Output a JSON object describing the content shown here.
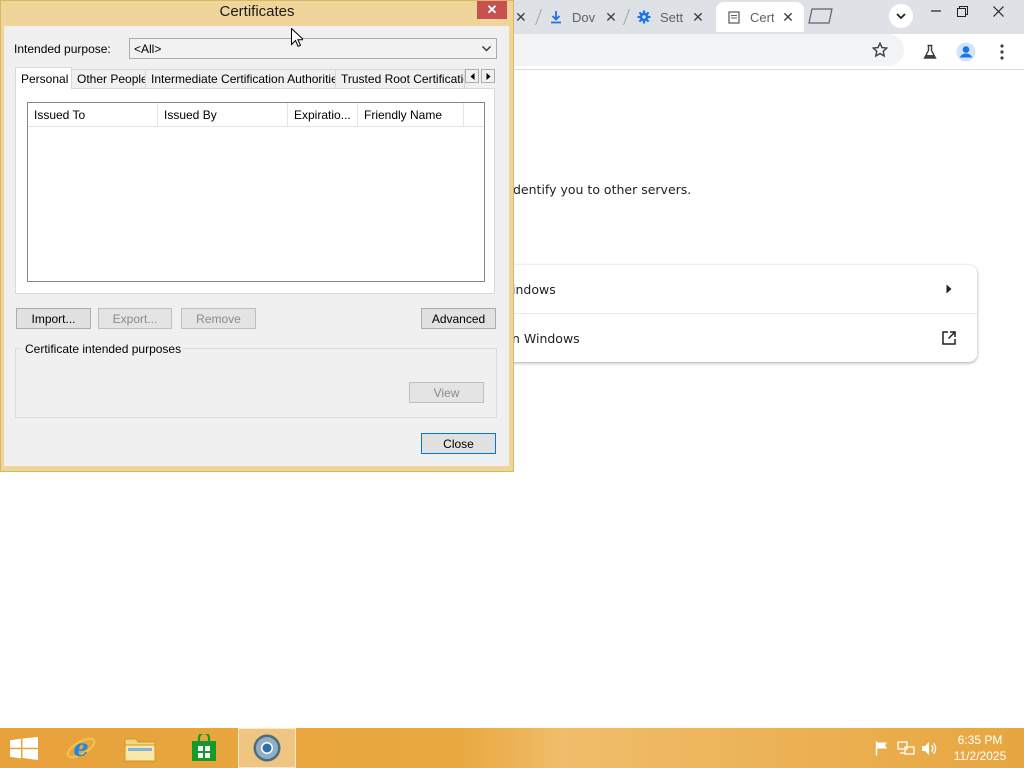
{
  "browser": {
    "tabs": [
      {
        "title": "Dov"
      },
      {
        "title": "Sett"
      },
      {
        "title": "Cert"
      }
    ],
    "content_text": "dentify you to other servers.",
    "card": {
      "row1_label": "indows",
      "row2_label": "n Windows"
    }
  },
  "dialog": {
    "title": "Certificates",
    "close_glyph": "✕",
    "intended_purpose_label": "Intended purpose:",
    "intended_purpose_value": "<All>",
    "tabs": [
      {
        "label": "Personal"
      },
      {
        "label": "Other People"
      },
      {
        "label": "Intermediate Certification Authorities"
      },
      {
        "label": "Trusted Root Certification"
      }
    ],
    "columns": [
      "Issued To",
      "Issued By",
      "Expiratio...",
      "Friendly Name"
    ],
    "buttons": {
      "import": "Import...",
      "export": "Export...",
      "remove": "Remove",
      "advanced": "Advanced",
      "view": "View",
      "close": "Close"
    },
    "group_title": "Certificate intended purposes"
  },
  "taskbar": {
    "time": "6:35 PM",
    "date": "11/2/2025"
  },
  "colors": {
    "dialog_frame": "#efd59a",
    "close_red": "#c75050",
    "taskbar": "#e8a23b",
    "chrome_tabstrip": "#dee1e6"
  },
  "icons": [
    "download-icon",
    "gear-icon",
    "certificate-icon",
    "star-icon",
    "flask-icon",
    "profile-icon",
    "menu-icon",
    "external-link-icon",
    "chevron-right-icon",
    "ie-icon",
    "explorer-icon",
    "store-icon",
    "chrome-icon",
    "flag-icon",
    "network-icon",
    "speaker-icon"
  ]
}
